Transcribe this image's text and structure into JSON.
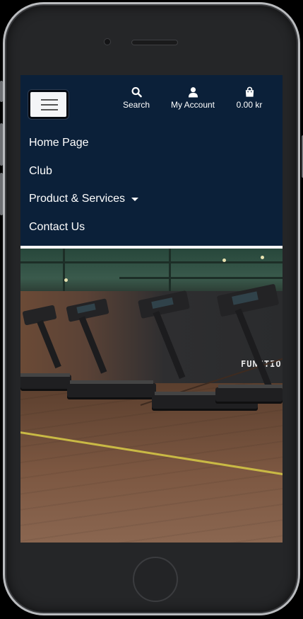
{
  "navbar": {
    "menu_toggle_label": "Toggle navigation",
    "actions": {
      "search_label": "Search",
      "account_label": "My Account",
      "cart_label": "0.00 kr"
    },
    "menu_items": [
      {
        "label": "Home Page"
      },
      {
        "label": "Club"
      },
      {
        "label": "Product & Services",
        "has_dropdown": true
      },
      {
        "label": "Contact Us"
      }
    ]
  },
  "hero": {
    "wall_text": "FUNCTIO"
  },
  "colors": {
    "navbar_bg": "#0b2039",
    "text": "#ffffff",
    "toggler_bg": "#f4f5f7",
    "phone_frame": "#252628"
  },
  "icons": [
    "search-icon",
    "user-icon",
    "shopping-bag-icon",
    "hamburger-icon",
    "caret-down-icon"
  ]
}
